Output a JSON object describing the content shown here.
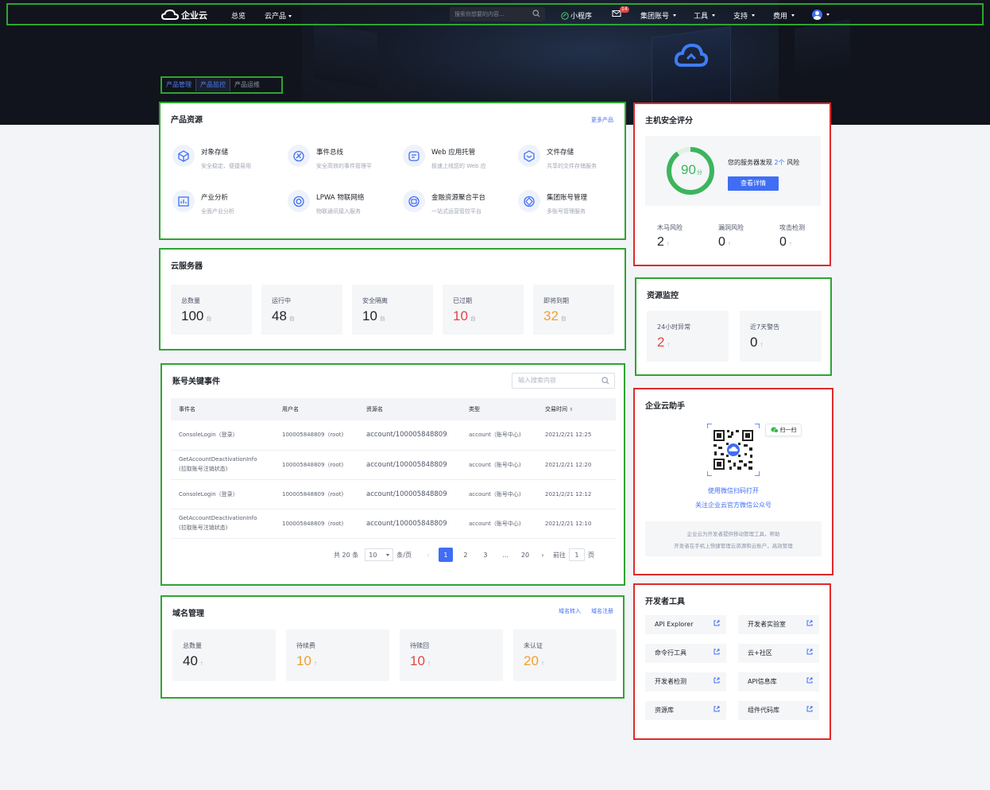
{
  "header": {
    "brand": "企业云",
    "nav_overview": "总览",
    "nav_products": "云产品",
    "search_placeholder": "搜索你想要的内容...",
    "mini_program": "小程序",
    "mail_badge": "14",
    "group_account": "集团账号",
    "tools": "工具",
    "support": "支持",
    "billing": "费用"
  },
  "tabs": [
    "产品管理",
    "产品监控",
    "产品运维"
  ],
  "product_resources": {
    "title": "产品资源",
    "more_link": "更多产品",
    "items": [
      {
        "name": "对象存储",
        "desc": "安全稳定、便捷易用",
        "icon": "cube-icon"
      },
      {
        "name": "事件总线",
        "desc": "安全高效的事件管理平",
        "icon": "event-bus-icon"
      },
      {
        "name": "Web 应用托管",
        "desc": "极速上线您的 Web 应",
        "icon": "web-hosting-icon"
      },
      {
        "name": "文件存储",
        "desc": "共享的文件存储服务",
        "icon": "file-storage-icon"
      },
      {
        "name": "产业分析",
        "desc": "全面产业分析",
        "icon": "analytics-icon"
      },
      {
        "name": "LPWA 物联网络",
        "desc": "物联通讯接入服务",
        "icon": "iot-icon"
      },
      {
        "name": "金融资源聚合平台",
        "desc": "一站式运营管控平台",
        "icon": "finance-icon"
      },
      {
        "name": "集团账号管理",
        "desc": "多账号管理服务",
        "icon": "group-account-icon"
      }
    ]
  },
  "cloud_servers": {
    "title": "云服务器",
    "unit": "台",
    "stats": [
      {
        "label": "总数量",
        "value": "100"
      },
      {
        "label": "运行中",
        "value": "48"
      },
      {
        "label": "安全隔离",
        "value": "10"
      },
      {
        "label": "已过期",
        "value": "10"
      },
      {
        "label": "即将到期",
        "value": "32"
      }
    ]
  },
  "key_events": {
    "title": "账号关键事件",
    "search_placeholder": "输入搜索内容",
    "columns": [
      "事件名",
      "用户名",
      "资源名",
      "类型",
      "交易时间"
    ],
    "rows": [
      {
        "event": "ConsoleLogin（登录）",
        "event2": "",
        "user": "100005848809（root)",
        "resource": "account/100005848809",
        "type": "account（账号中心)",
        "time": "2021/2/21 12:25"
      },
      {
        "event": "GetAccountDeactivationInfo",
        "event2": "(拉取账号注销状态)",
        "user": "100005848809（root)",
        "resource": "account/100005848809",
        "type": "account（账号中心)",
        "time": "2021/2/21 12:20"
      },
      {
        "event": "ConsoleLogin（登录）",
        "event2": "",
        "user": "100005848809（root)",
        "resource": "account/100005848809",
        "type": "account（账号中心)",
        "time": "2021/2/21 12:12"
      },
      {
        "event": "GetAccountDeactivationInfo",
        "event2": "(拉取账号注销状态)",
        "user": "100005848809（root)",
        "resource": "account/100005848809",
        "type": "account（账号中心)",
        "time": "2021/2/21 12:10"
      }
    ],
    "pager": {
      "total": "共 20 条",
      "page_size": "10",
      "per_page": "条/页",
      "pages": [
        "1",
        "2",
        "3",
        "...",
        "20"
      ],
      "goto_label": "前往",
      "goto_value": "1",
      "page_suffix": "页"
    }
  },
  "domains": {
    "title": "域名管理",
    "link_transfer": "域名转入",
    "link_register": "域名注册",
    "stats": [
      {
        "label": "总数量",
        "value": "40"
      },
      {
        "label": "待续费",
        "value": "10"
      },
      {
        "label": "待赎回",
        "value": "10"
      },
      {
        "label": "未认证",
        "value": "20"
      }
    ]
  },
  "host_security": {
    "title": "主机安全评分",
    "score": "90",
    "score_unit": "分",
    "score_fraction": 0.9,
    "msg_prefix": "您的服务器发现",
    "msg_count": "2个",
    "msg_suffix": "风险",
    "button": "查看详情",
    "stats": [
      {
        "label": "木马风险",
        "value": "2"
      },
      {
        "label": "漏洞风险",
        "value": "0"
      },
      {
        "label": "攻击检测",
        "value": "0"
      }
    ]
  },
  "resource_monitor": {
    "title": "资源监控",
    "stats": [
      {
        "label": "24小时异常",
        "value": "2"
      },
      {
        "label": "近7天警告",
        "value": "0"
      }
    ]
  },
  "assistant": {
    "title": "企业云助手",
    "scan_tag": "扫一扫",
    "line1": "使用微信扫码打开",
    "line2": "关注企业云官方微信公众号",
    "desc1": "企业云为开发者提供移动管理工具，帮助",
    "desc2": "开发者在手机上快捷管理云资源和云账户，高效管理"
  },
  "dev_tools": {
    "title": "开发者工具",
    "items": [
      "API Explorer",
      "开发者实验室",
      "命令行工具",
      "云+社区",
      "开发者检测",
      "API信息库",
      "资源库",
      "组件代码库"
    ]
  },
  "colors": {
    "accent": "#3f6ef5",
    "success": "#2ea531",
    "danger": "#e54545",
    "warning": "#f0a030"
  }
}
